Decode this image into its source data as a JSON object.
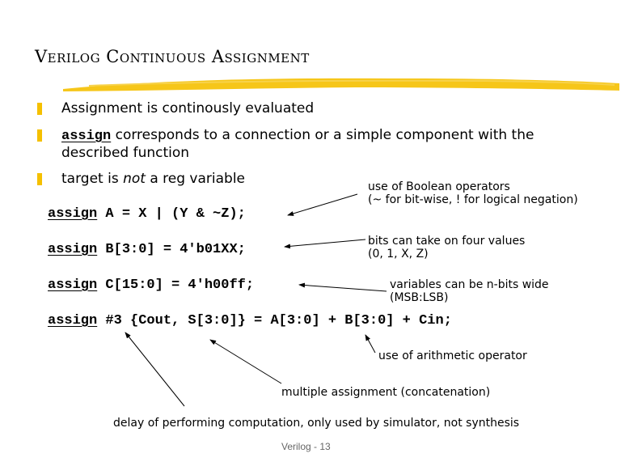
{
  "slide": {
    "title": "Verilog Continuous Assignment",
    "accent_color": "#f5c000",
    "bullets": [
      {
        "text": "Assignment is continously evaluated"
      },
      {
        "keyword": "assign",
        "text": " corresponds to a connection or a simple component with the",
        "text2": "described function"
      },
      {
        "pre": "target is ",
        "italic": "not",
        "post": " a reg variable"
      }
    ],
    "code_lines": [
      {
        "keyword": "assign",
        "rest": " A = X | (Y & ~Z);"
      },
      {
        "keyword": "assign",
        "rest": " B[3:0] = 4'b01XX;"
      },
      {
        "keyword": "assign",
        "rest": " C[15:0] = 4'h00ff;"
      },
      {
        "keyword": "assign",
        "rest": " #3 {Cout, S[3:0]} = A[3:0] + B[3:0] + Cin;"
      }
    ],
    "annotations": [
      {
        "line1": "use of Boolean operators",
        "line2": "(~ for bit-wise, ! for logical negation)"
      },
      {
        "line1": "bits can take on four values",
        "line2": "(0, 1, X, Z)"
      },
      {
        "line1": "variables can be n-bits wide",
        "line2": "(MSB:LSB)"
      },
      {
        "line1": "use of arithmetic operator"
      },
      {
        "line1": "multiple assignment (concatenation)"
      },
      {
        "line1": "delay of performing computation, only used by simulator, not synthesis"
      }
    ],
    "footer": "Verilog - 13"
  }
}
